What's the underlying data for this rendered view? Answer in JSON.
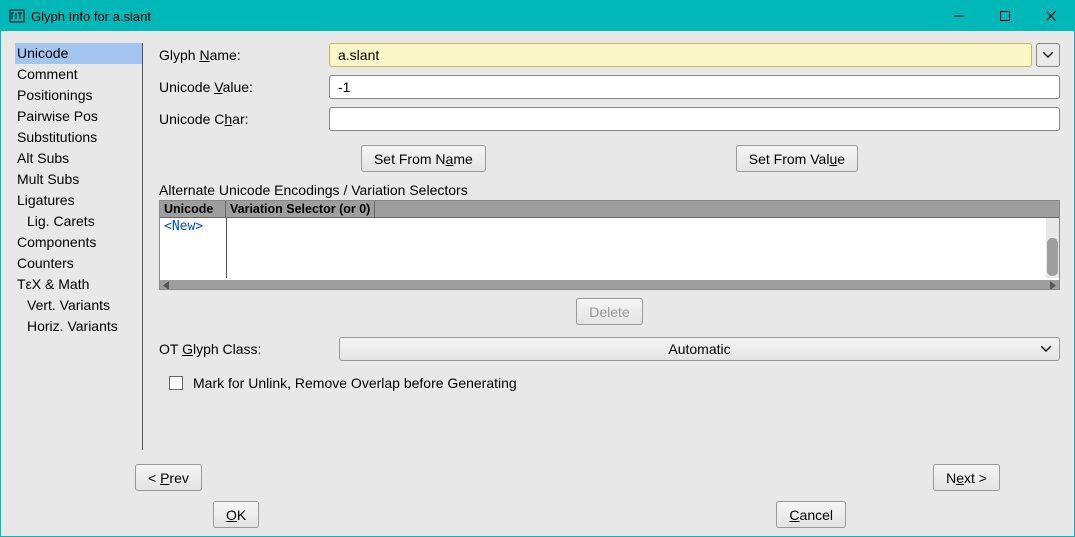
{
  "titlebar": {
    "title": "Glyph Info for a.slant"
  },
  "sidebar": {
    "items": [
      {
        "label": "Unicode",
        "selected": true,
        "indent": false
      },
      {
        "label": "Comment",
        "selected": false,
        "indent": false
      },
      {
        "label": "Positionings",
        "selected": false,
        "indent": false
      },
      {
        "label": "Pairwise Pos",
        "selected": false,
        "indent": false
      },
      {
        "label": "Substitutions",
        "selected": false,
        "indent": false
      },
      {
        "label": "Alt Subs",
        "selected": false,
        "indent": false
      },
      {
        "label": "Mult Subs",
        "selected": false,
        "indent": false
      },
      {
        "label": "Ligatures",
        "selected": false,
        "indent": false
      },
      {
        "label": "Lig. Carets",
        "selected": false,
        "indent": true
      },
      {
        "label": "Components",
        "selected": false,
        "indent": false
      },
      {
        "label": "Counters",
        "selected": false,
        "indent": false
      },
      {
        "label": "TεX & Math",
        "selected": false,
        "indent": false
      },
      {
        "label": "Vert. Variants",
        "selected": false,
        "indent": true
      },
      {
        "label": "Horiz. Variants",
        "selected": false,
        "indent": true
      }
    ]
  },
  "fields": {
    "glyph_name_label_pre": "Glyph ",
    "glyph_name_label_u": "N",
    "glyph_name_label_post": "ame:",
    "glyph_name_value": "a.slant",
    "unicode_value_label_pre": "Unicode ",
    "unicode_value_label_u": "V",
    "unicode_value_label_post": "alue:",
    "unicode_value_value": "-1",
    "unicode_char_label_pre": "Unicode C",
    "unicode_char_label_u": "h",
    "unicode_char_label_post": "ar:",
    "unicode_char_value": ""
  },
  "buttons": {
    "set_from_name_pre": "Set From N",
    "set_from_name_u": "a",
    "set_from_name_post": "me",
    "set_from_value_pre": "Set From Val",
    "set_from_value_u": "u",
    "set_from_value_post": "e",
    "delete": "Delete",
    "prev_pre": "< ",
    "prev_u": "P",
    "prev_post": "rev",
    "next_pre": "N",
    "next_u": "e",
    "next_post": "xt >",
    "ok_u": "O",
    "ok_post": "K",
    "cancel_u": "C",
    "cancel_post": "ancel"
  },
  "alt": {
    "heading": "Alternate Unicode Encodings / Variation Selectors",
    "col1": "Unicode",
    "col2": "Variation Selector (or 0)",
    "newrow": "<New>"
  },
  "ot": {
    "label_pre": "OT ",
    "label_u": "G",
    "label_post": "lyph Class:",
    "value": "Automatic"
  },
  "mark": {
    "label": "Mark for Unlink, Remove Overlap before Generating"
  }
}
